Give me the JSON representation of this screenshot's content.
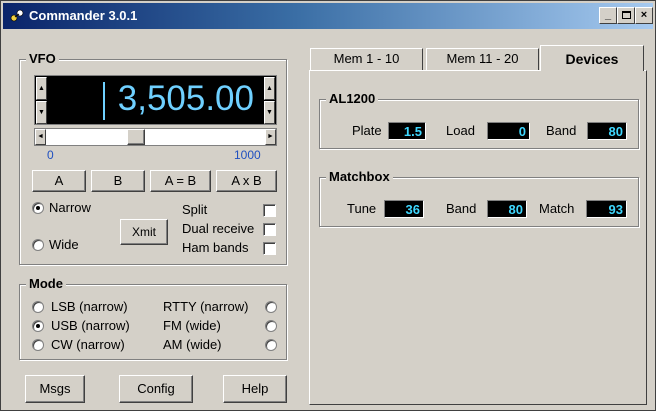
{
  "window": {
    "title": "Commander 3.0.1"
  },
  "vfo": {
    "label": "VFO",
    "frequency": "3,505.00",
    "slider_min": "0",
    "slider_max": "1000",
    "slider_level_percent": 40,
    "buttons": {
      "a": "A",
      "b": "B",
      "a_eq_b": "A = B",
      "a_x_b": "A x B"
    },
    "narrow_label": "Narrow",
    "wide_label": "Wide",
    "xmit_label": "Xmit",
    "split_label": "Split",
    "dual_receive_label": "Dual receive",
    "ham_bands_label": "Ham bands",
    "narrow_selected": true
  },
  "mode": {
    "label": "Mode",
    "options": [
      {
        "label": "LSB (narrow)",
        "selected": false
      },
      {
        "label": "USB (narrow)",
        "selected": true
      },
      {
        "label": "CW (narrow)",
        "selected": false
      },
      {
        "label": "RTTY (narrow)",
        "selected": false
      },
      {
        "label": "FM (wide)",
        "selected": false
      },
      {
        "label": "AM (wide)",
        "selected": false
      }
    ]
  },
  "bottom_buttons": {
    "msgs": "Msgs",
    "config": "Config",
    "help": "Help"
  },
  "tabs": [
    {
      "label": "Mem 1 - 10",
      "active": false
    },
    {
      "label": "Mem 11 - 20",
      "active": false
    },
    {
      "label": "Devices",
      "active": true
    }
  ],
  "al1200": {
    "label": "AL1200",
    "plate_label": "Plate",
    "plate_value": "1.5",
    "load_label": "Load",
    "load_value": "0",
    "band_label": "Band",
    "band_value": "80"
  },
  "matchbox": {
    "label": "Matchbox",
    "tune_label": "Tune",
    "tune_value": "36",
    "band_label": "Band",
    "band_value": "80",
    "match_label": "Match",
    "match_value": "93"
  },
  "colors": {
    "readout_text": "#3fd8ff",
    "readout_bg": "#000000",
    "frequency_text": "#6fd0ff",
    "title_bar": "#0a246a"
  }
}
